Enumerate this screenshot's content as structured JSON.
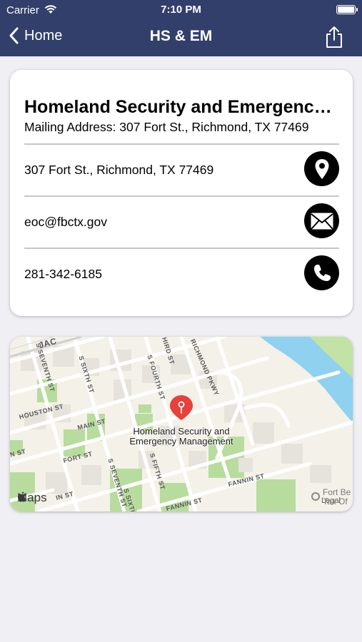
{
  "status_bar": {
    "carrier": "Carrier",
    "time": "7:10 PM"
  },
  "nav": {
    "back_label": "Home",
    "title": "HS & EM"
  },
  "contact": {
    "title": "Homeland Security and Emergency Management",
    "mailing": "Mailing Address: 307 Fort St., Richmond, TX 77469",
    "address": "307 Fort St., Richmond, TX 77469",
    "email": "eoc@fbctx.gov",
    "phone": " 281-342-6185"
  },
  "map": {
    "pin_label_line1": "Homeland Security and",
    "pin_label_line2": "Emergency Management",
    "streets": [
      "JAC",
      "S SEVENTH ST",
      "S SIXTH ST",
      "S FOURTH ST",
      "THIRD ST",
      "RICHMOND PKWY",
      "HOUSTON ST",
      "MAIN ST",
      "N ST",
      "FORT ST",
      "S FIFTH ST",
      "S SEVENTH ST",
      "S SIXTH ST",
      "IN ST",
      "FANNIN ST",
      "FANNIN ST"
    ],
    "maps_logo": "Maps",
    "legal": "Legal",
    "fortbend_line1": "Fort Be",
    "fortbend_line2": "Tax Of",
    "colors": {
      "land": "#f4f1e9",
      "park": "#b8dc9e",
      "water": "#8fd1ee",
      "road": "#ffffff",
      "pin": "#e8403a"
    }
  }
}
